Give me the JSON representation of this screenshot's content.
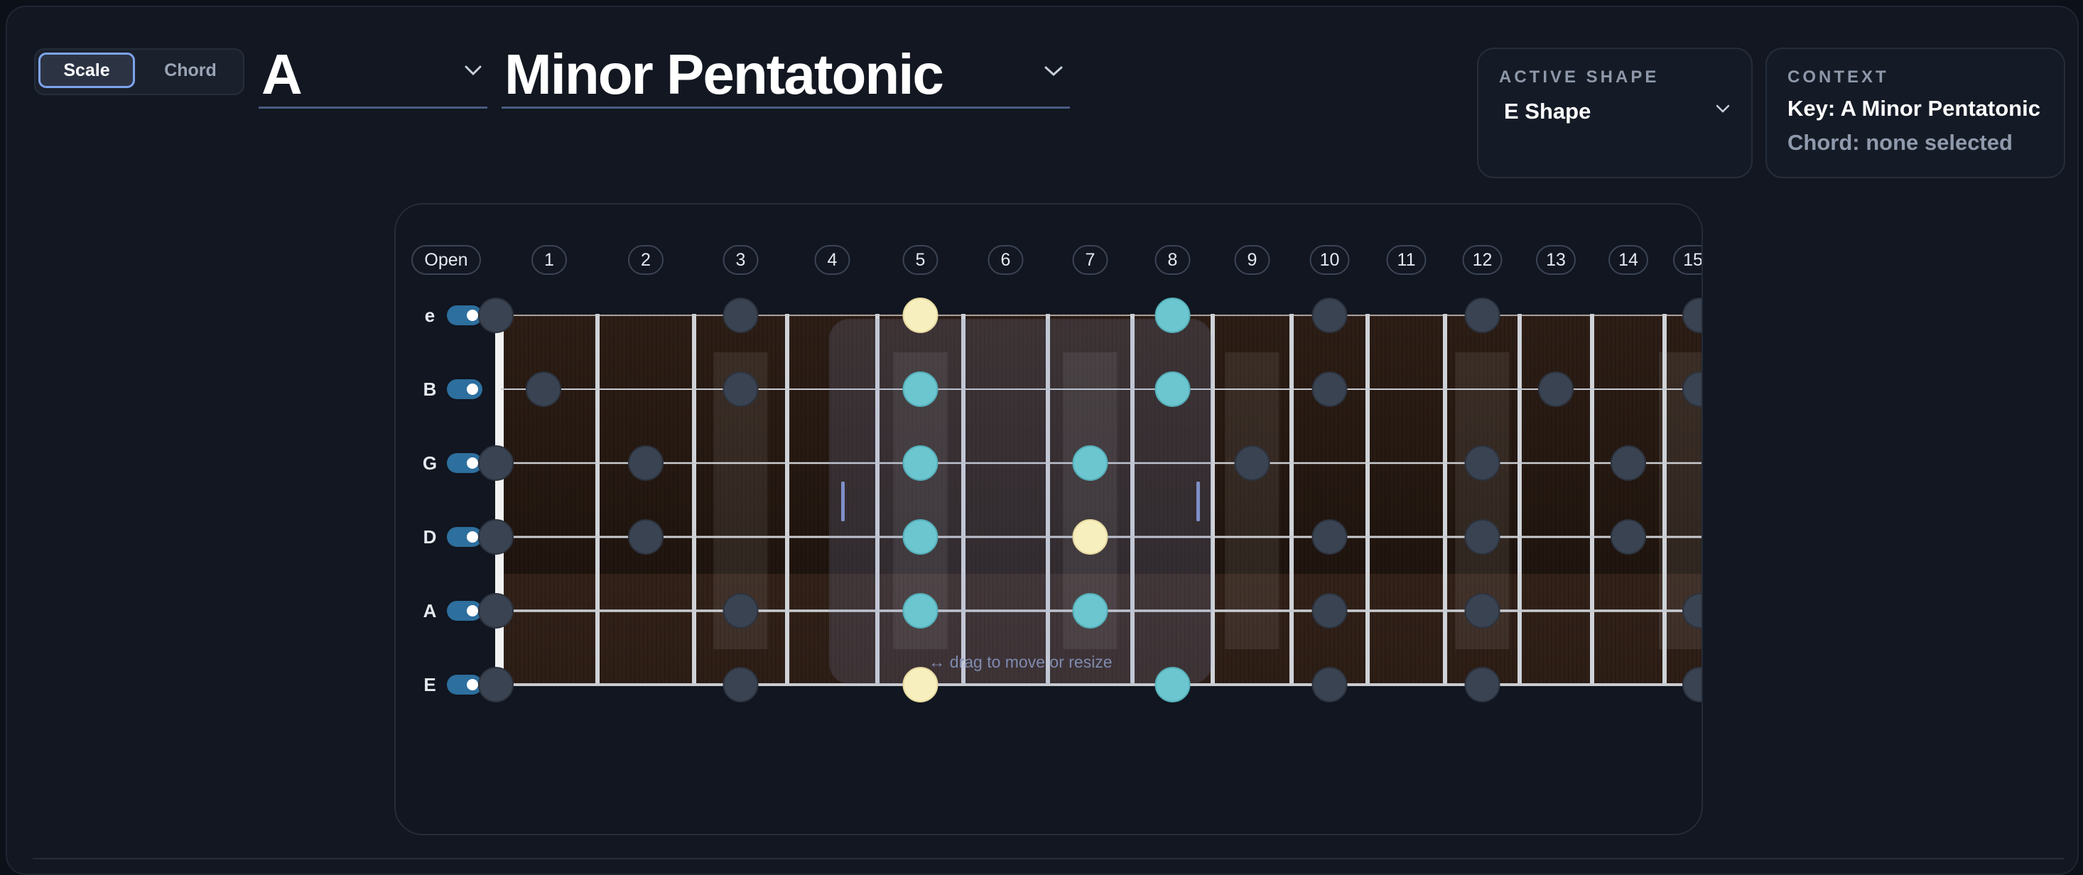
{
  "mode": {
    "scale_label": "Scale",
    "chord_label": "Chord",
    "active": "Scale"
  },
  "key": {
    "value": "A"
  },
  "scale": {
    "value": "Minor Pentatonic"
  },
  "active_shape": {
    "label": "ACTIVE SHAPE",
    "value": "E Shape"
  },
  "context": {
    "label": "CONTEXT",
    "key_text": "Key: A Minor Pentatonic",
    "chord_text": "Chord: none selected"
  },
  "fretboard": {
    "fret_labels": [
      "Open",
      "1",
      "2",
      "3",
      "4",
      "5",
      "6",
      "7",
      "8",
      "9",
      "10",
      "11",
      "12",
      "13",
      "14",
      "15"
    ],
    "strings": [
      "e",
      "B",
      "G",
      "D",
      "A",
      "E"
    ],
    "string_enabled": [
      true,
      true,
      true,
      true,
      true,
      true
    ],
    "shape_hint": "↔ drag to move or resize",
    "shape_fret_range": [
      5,
      8
    ],
    "notes": [
      {
        "string": 0,
        "fret": 0,
        "role": "scale"
      },
      {
        "string": 0,
        "fret": 3,
        "role": "scale"
      },
      {
        "string": 0,
        "fret": 5,
        "role": "root"
      },
      {
        "string": 0,
        "fret": 8,
        "role": "shape"
      },
      {
        "string": 0,
        "fret": 10,
        "role": "scale"
      },
      {
        "string": 0,
        "fret": 12,
        "role": "scale"
      },
      {
        "string": 0,
        "fret": 15,
        "role": "scale"
      },
      {
        "string": 1,
        "fret": 1,
        "role": "scale"
      },
      {
        "string": 1,
        "fret": 3,
        "role": "scale"
      },
      {
        "string": 1,
        "fret": 5,
        "role": "shape"
      },
      {
        "string": 1,
        "fret": 8,
        "role": "shape"
      },
      {
        "string": 1,
        "fret": 10,
        "role": "scale"
      },
      {
        "string": 1,
        "fret": 13,
        "role": "scale"
      },
      {
        "string": 1,
        "fret": 15,
        "role": "scale"
      },
      {
        "string": 2,
        "fret": 0,
        "role": "scale"
      },
      {
        "string": 2,
        "fret": 2,
        "role": "scale"
      },
      {
        "string": 2,
        "fret": 5,
        "role": "shape"
      },
      {
        "string": 2,
        "fret": 7,
        "role": "shape"
      },
      {
        "string": 2,
        "fret": 9,
        "role": "scale"
      },
      {
        "string": 2,
        "fret": 12,
        "role": "scale"
      },
      {
        "string": 2,
        "fret": 14,
        "role": "scale"
      },
      {
        "string": 3,
        "fret": 0,
        "role": "scale"
      },
      {
        "string": 3,
        "fret": 2,
        "role": "scale"
      },
      {
        "string": 3,
        "fret": 5,
        "role": "shape"
      },
      {
        "string": 3,
        "fret": 7,
        "role": "root"
      },
      {
        "string": 3,
        "fret": 10,
        "role": "scale"
      },
      {
        "string": 3,
        "fret": 12,
        "role": "scale"
      },
      {
        "string": 3,
        "fret": 14,
        "role": "scale"
      },
      {
        "string": 4,
        "fret": 0,
        "role": "scale"
      },
      {
        "string": 4,
        "fret": 3,
        "role": "scale"
      },
      {
        "string": 4,
        "fret": 5,
        "role": "shape"
      },
      {
        "string": 4,
        "fret": 7,
        "role": "shape"
      },
      {
        "string": 4,
        "fret": 10,
        "role": "scale"
      },
      {
        "string": 4,
        "fret": 12,
        "role": "scale"
      },
      {
        "string": 4,
        "fret": 15,
        "role": "scale"
      },
      {
        "string": 5,
        "fret": 0,
        "role": "scale"
      },
      {
        "string": 5,
        "fret": 3,
        "role": "scale"
      },
      {
        "string": 5,
        "fret": 5,
        "role": "root"
      },
      {
        "string": 5,
        "fret": 8,
        "role": "shape"
      },
      {
        "string": 5,
        "fret": 10,
        "role": "scale"
      },
      {
        "string": 5,
        "fret": 12,
        "role": "scale"
      },
      {
        "string": 5,
        "fret": 15,
        "role": "scale"
      }
    ],
    "inlay_frets": [
      3,
      5,
      7,
      9,
      12,
      15
    ],
    "colors": {
      "root": "#f8efbf",
      "shape": "#6cc6cf",
      "scale": "#3a4351",
      "toggle": "#2d6f9e",
      "wood": "#2a1e17"
    }
  }
}
